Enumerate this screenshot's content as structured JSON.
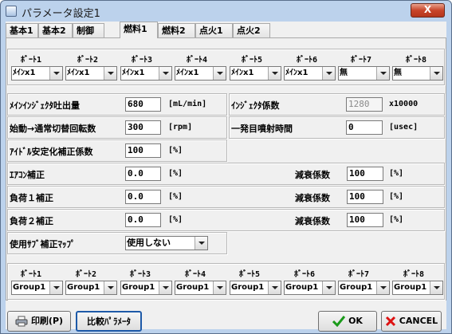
{
  "window": {
    "title": "パラメータ設定1",
    "close_label": "X"
  },
  "tabs": [
    "基本1",
    "基本2",
    "制御",
    "燃料1",
    "燃料2",
    "点火1",
    "点火2"
  ],
  "bank_headers": [
    "ﾎﾞｰﾄ1",
    "ﾎﾞｰﾄ2",
    "ﾎﾞｰﾄ3",
    "ﾎﾞｰﾄ4",
    "ﾎﾞｰﾄ5",
    "ﾎﾞｰﾄ6",
    "ﾎﾞｰﾄ7",
    "ﾎﾞｰﾄ8"
  ],
  "bank_values": [
    "ﾒｲﾝx1",
    "ﾒｲﾝx1",
    "ﾒｲﾝx1",
    "ﾒｲﾝx1",
    "ﾒｲﾝx1",
    "ﾒｲﾝx1",
    "無",
    "無"
  ],
  "params": {
    "main_injector_flow": {
      "label": "ﾒｲﾝｲﾝｼﾞｪｸﾀ吐出量",
      "value": "680",
      "unit": "[mL/min]"
    },
    "injector_coef": {
      "label": "ｲﾝｼﾞｪｸﾀ係数",
      "value": "1280",
      "unit": "x10000"
    },
    "start_switch_rpm": {
      "label": "始動→通常切替回転数",
      "value": "300",
      "unit": "[rpm]"
    },
    "first_injection_time": {
      "label": "一発目噴射時間",
      "value": "0",
      "unit": "[usec]"
    },
    "idle_stable_coef": {
      "label": "ｱｲﾄﾞﾙ安定化補正係数",
      "value": "100",
      "unit": "[%]"
    },
    "aircon_correction": {
      "label": "ｴｱｺﾝ補正",
      "value": "0.0",
      "unit": "[%]",
      "decay_label": "減衰係数",
      "decay_value": "100",
      "decay_unit": "[%]"
    },
    "load1_correction": {
      "label": "負荷１補正",
      "value": "0.0",
      "unit": "[%]",
      "decay_label": "減衰係数",
      "decay_value": "100",
      "decay_unit": "[%]"
    },
    "load2_correction": {
      "label": "負荷２補正",
      "value": "0.0",
      "unit": "[%]",
      "decay_label": "減衰係数",
      "decay_value": "100",
      "decay_unit": "[%]"
    },
    "sub_map": {
      "label": "使用ｻﾌﾞ補正ﾏｯﾌﾟ",
      "value": "使用しない"
    }
  },
  "group_headers": [
    "ﾎﾞｰﾄ1",
    "ﾎﾞｰﾄ2",
    "ﾎﾞｰﾄ3",
    "ﾎﾞｰﾄ4",
    "ﾎﾞｰﾄ5",
    "ﾎﾞｰﾄ6",
    "ﾎﾞｰﾄ7",
    "ﾎﾞｰﾄ8"
  ],
  "group_values": [
    "Group1",
    "Group1",
    "Group1",
    "Group1",
    "Group1",
    "Group1",
    "Group1",
    "Group1"
  ],
  "buttons": {
    "print": "印刷(P)",
    "compare": "比較ﾊﾟﾗﾒｰﾀ",
    "ok": "OK",
    "cancel": "CANCEL"
  }
}
